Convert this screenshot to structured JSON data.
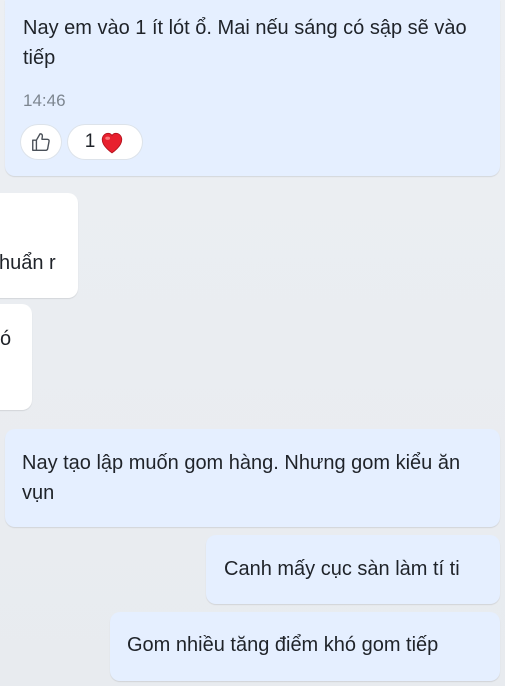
{
  "messages": [
    {
      "text": "Nay em vào 1 ít lót ổ. Mai nếu sáng có sập sẽ vào tiếp",
      "time": "14:46",
      "reaction_count": "1"
    },
    {
      "text": "huẩn r"
    },
    {
      "text": "ó"
    },
    {
      "text": "Nay tạo lập muốn gom hàng. Nhưng gom kiểu ăn vụn"
    },
    {
      "text": "Canh mấy cục sàn làm tí ti"
    },
    {
      "text": "Gom nhiều tăng điểm khó gom tiếp"
    }
  ],
  "colors": {
    "own_bubble": "#e5efff",
    "other_bubble": "#ffffff",
    "heart": "#e8202e",
    "background": "#eceff3"
  },
  "icons": {
    "like": "thumbs-up-icon",
    "heart": "heart-icon"
  }
}
